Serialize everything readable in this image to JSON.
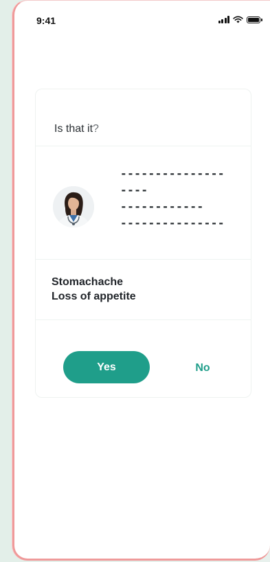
{
  "status_bar": {
    "time": "9:41",
    "icons": [
      "signal-icon",
      "wifi-icon",
      "battery-icon"
    ]
  },
  "card": {
    "title": "Is that it",
    "title_mark": "?",
    "doctor": {
      "avatar": "doctor-avatar",
      "placeholder_lines": [
        "---------------",
        "----",
        "------------",
        "---------------"
      ]
    },
    "symptoms": [
      "Stomachache",
      "Loss of appetite"
    ],
    "actions": {
      "yes_label": "Yes",
      "no_label": "No"
    }
  },
  "colors": {
    "accent": "#1f9e8a",
    "frame_border": "#ef9a9a",
    "background": "#e6f0ec"
  }
}
